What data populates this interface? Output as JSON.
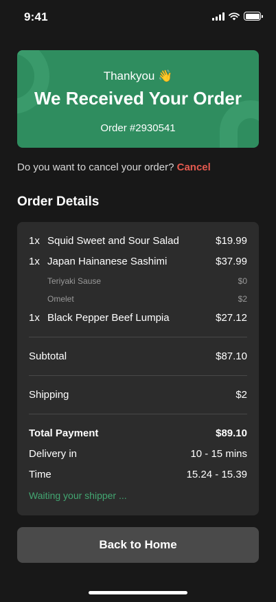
{
  "status_bar": {
    "time": "9:41"
  },
  "banner": {
    "thanks": "Thankyou 👋",
    "title": "We Received Your Order",
    "order_number": "Order #2930541",
    "color": "#2f8d5f"
  },
  "cancel": {
    "question": "Do you want to cancel your order? ",
    "link_label": "Cancel",
    "link_color": "#e45a4f"
  },
  "order_details": {
    "title": "Order Details",
    "items": [
      {
        "qty": "1x",
        "name": "Squid Sweet and Sour Salad",
        "price": "$19.99"
      },
      {
        "qty": "1x",
        "name": "Japan Hainanese Sashimi",
        "price": "$37.99",
        "addons": [
          {
            "name": "Teriyaki Sause",
            "price": "$0"
          },
          {
            "name": "Omelet",
            "price": "$2"
          }
        ]
      },
      {
        "qty": "1x",
        "name": "Black Pepper Beef Lumpia",
        "price": "$27.12"
      }
    ],
    "subtotal_label": "Subtotal",
    "subtotal_value": "$87.10",
    "shipping_label": "Shipping",
    "shipping_value": "$2",
    "total_label": "Total Payment",
    "total_value": "$89.10",
    "delivery_label": "Delivery in",
    "delivery_value": "10 - 15 mins",
    "time_label": "Time",
    "time_value": "15.24 - 15.39",
    "shipper_status": "Waiting your shipper ...",
    "status_color": "#43a772"
  },
  "home_button": {
    "label": "Back to Home"
  }
}
